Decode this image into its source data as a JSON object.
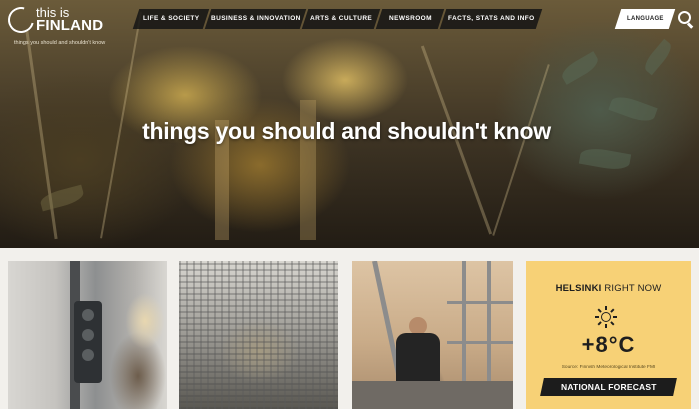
{
  "brand": {
    "small": "this is",
    "big": "FINLAND",
    "tagline": "things you should and shouldn't know"
  },
  "nav": {
    "items": [
      "LIFE & SOCIETY",
      "BUSINESS & INNOVATION",
      "ARTS & CULTURE",
      "NEWSROOM",
      "FACTS, STATS AND INFO"
    ],
    "language_label": "LANGUAGE"
  },
  "hero": {
    "headline": "things you should and shouldn't know"
  },
  "weather": {
    "city": "HELSINKI",
    "suffix": "RIGHT NOW",
    "icon": "sun-icon",
    "temperature": "+8°C",
    "source": "Source: Finnish Meteorological Institute FMI",
    "forecast_button": "NATIONAL FORECAST"
  },
  "colors": {
    "weather_bg": "#f7d176",
    "nav_bg": "#141414",
    "page_bg": "#f2f0ec"
  }
}
